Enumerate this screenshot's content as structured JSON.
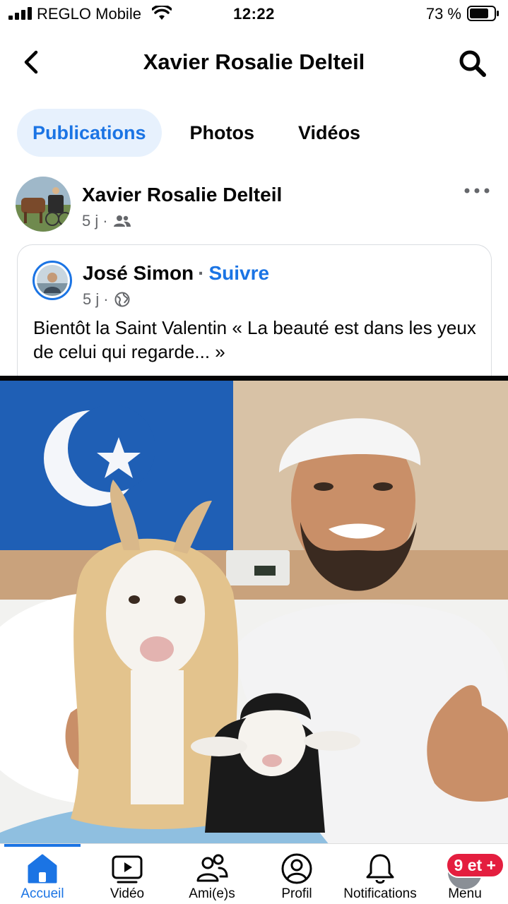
{
  "status_bar": {
    "carrier": "REGLO Mobile",
    "time": "12:22",
    "battery": "73 %"
  },
  "header": {
    "title": "Xavier Rosalie Delteil",
    "back_icon": "chevron-left-icon",
    "search_icon": "search-icon"
  },
  "tabs": [
    {
      "label": "Publications",
      "active": true
    },
    {
      "label": "Photos",
      "active": false
    },
    {
      "label": "Vidéos",
      "active": false
    }
  ],
  "post": {
    "author": "Xavier Rosalie Delteil",
    "time": "5 j",
    "separator": "·",
    "audience_icon": "friends-icon",
    "more_icon": "more-horizontal-icon",
    "shared": {
      "author": "José Simon",
      "separator": "·",
      "follow_label": "Suivre",
      "time": "5 j",
      "audience_icon": "globe-icon",
      "text": "Bientôt la Saint Valentin « La beauté est dans les yeux de celui qui regarde... »"
    }
  },
  "bottom_nav": [
    {
      "label": "Accueil",
      "icon": "home-icon",
      "active": true
    },
    {
      "label": "Vidéo",
      "icon": "video-icon",
      "active": false
    },
    {
      "label": "Ami(e)s",
      "icon": "friends-icon",
      "active": false
    },
    {
      "label": "Profil",
      "icon": "profile-icon",
      "active": false
    },
    {
      "label": "Notifications",
      "icon": "bell-icon",
      "active": false
    },
    {
      "label": "Menu",
      "icon": "menu-avatar",
      "active": false,
      "badge": "9 et +"
    }
  ],
  "colors": {
    "accent": "#1b74e4",
    "tab_active_bg": "#e7f1fd",
    "badge": "#e41e3f",
    "secondary_text": "#65676b"
  }
}
